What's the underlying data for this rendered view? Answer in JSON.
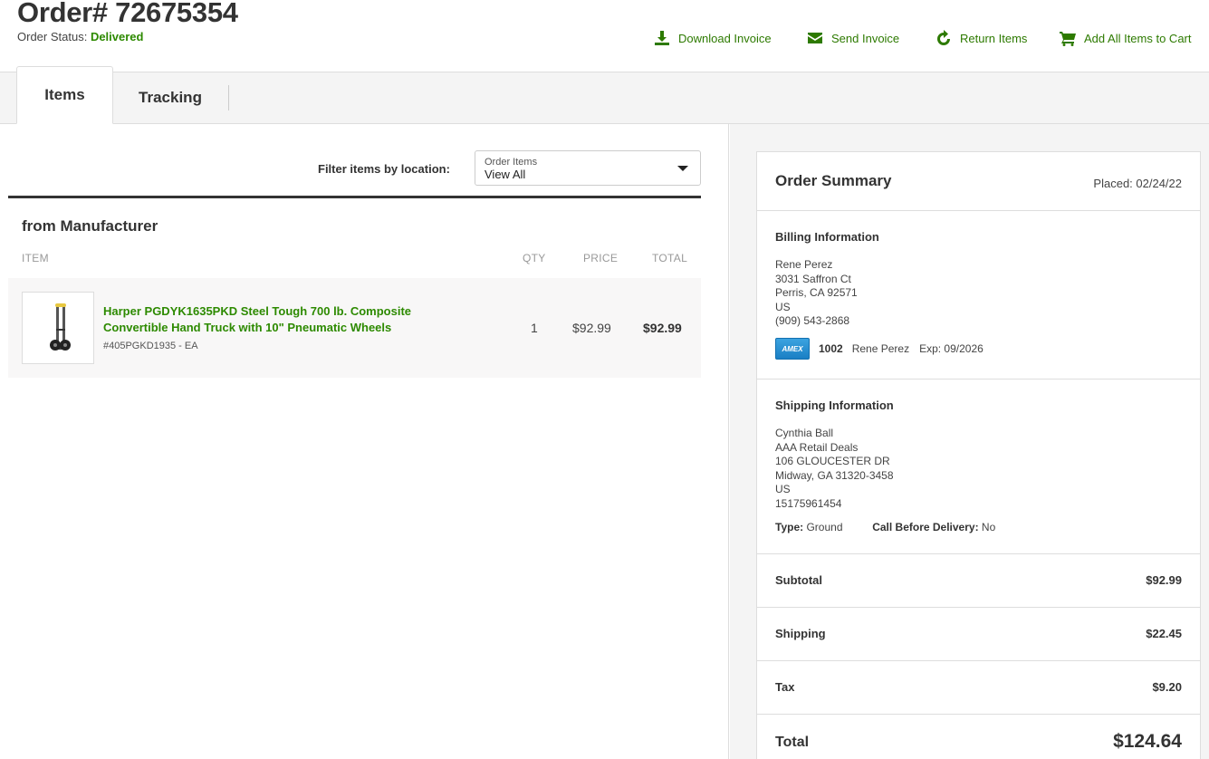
{
  "header": {
    "order_title": "Order# 72675354",
    "status_label": "Order Status:",
    "status_value": "Delivered",
    "actions": [
      {
        "label": "Download Invoice",
        "icon": "download-icon"
      },
      {
        "label": "Send Invoice",
        "icon": "envelope-icon"
      },
      {
        "label": "Return Items",
        "icon": "refresh-icon"
      },
      {
        "label": "Add All Items to Cart",
        "icon": "cart-icon"
      }
    ]
  },
  "tabs": [
    {
      "label": "Items",
      "active": true
    },
    {
      "label": "Tracking",
      "active": false
    }
  ],
  "filter": {
    "label": "Filter items by location:",
    "select_label": "Order Items",
    "select_value": "View All"
  },
  "group": {
    "title": "from Manufacturer",
    "columns": {
      "item": "ITEM",
      "qty": "QTY",
      "price": "PRICE",
      "total": "TOTAL"
    },
    "items": [
      {
        "name": "Harper PGDYK1635PKD Steel Tough 700 lb. Composite Convertible Hand Truck with 10\" Pneumatic Wheels",
        "sku": "#405PGKD1935 - EA",
        "qty": "1",
        "price": "$92.99",
        "total": "$92.99"
      }
    ]
  },
  "summary": {
    "title": "Order Summary",
    "placed": "Placed: 02/24/22",
    "billing": {
      "title": "Billing Information",
      "lines": [
        "Rene Perez",
        "3031 Saffron Ct",
        "Perris, CA 92571",
        "US",
        "(909) 543-2868"
      ],
      "card": {
        "brand": "AMEX",
        "last4": "1002",
        "name": "Rene Perez",
        "exp": "Exp: 09/2026"
      }
    },
    "shipping": {
      "title": "Shipping Information",
      "lines": [
        "Cynthia Ball",
        "AAA Retail Deals",
        "106 GLOUCESTER DR",
        "Midway, GA 31320-3458",
        "US",
        "15175961454"
      ],
      "type_label": "Type:",
      "type_value": "Ground",
      "call_label": "Call Before Delivery:",
      "call_value": "No"
    },
    "totals": [
      {
        "label": "Subtotal",
        "value": "$92.99"
      },
      {
        "label": "Shipping",
        "value": "$22.45"
      },
      {
        "label": "Tax",
        "value": "$9.20"
      }
    ],
    "grand_total": {
      "label": "Total",
      "value": "$124.64"
    }
  },
  "colors": {
    "accent_green": "#2d8a00",
    "status_green": "#2d8a00"
  }
}
